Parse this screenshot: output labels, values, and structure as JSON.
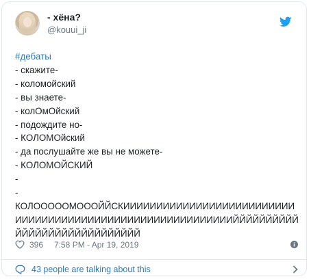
{
  "author": {
    "display_name": "- хёна?",
    "handle": "@kouui_ji"
  },
  "tweet": {
    "hashtag": "#дебаты",
    "lines": [
      "- скажите-",
      "- коломойский",
      "- вы знаете-",
      "- колОмОйский",
      "- подождите но-",
      "- КОЛОМОйский",
      "- да послушайте же вы не можете-",
      "- КОЛОМОЙСКИЙ",
      "-",
      "-",
      "КОЛОООООМОООЙЙСКИИИИИИИИИИИИИИИИИИИИИИИИИИИИИИИИИИИИИИИИИИИИИИИИИИИИИИИИИИИЙЙЙЙЙЙЙЙЙЙЙЙЙЙЙЙЙЙЙЙЙЙЙЙЙЙЙЙЙ"
    ]
  },
  "footer": {
    "likes": "396",
    "timestamp": "7:58 PM - Apr 19, 2019"
  },
  "conversation": {
    "label": "43 people are talking about this"
  },
  "colors": {
    "link": "#2b7bb9",
    "meta": "#697882",
    "border": "#e1e8ed",
    "twitter_blue": "#1da1f2"
  }
}
